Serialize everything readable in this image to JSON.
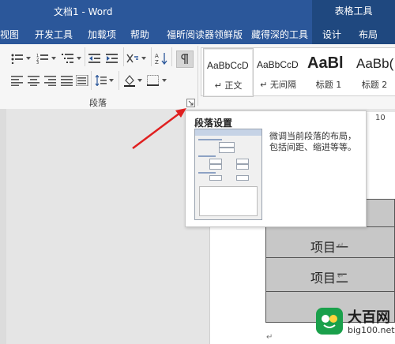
{
  "titlebar": {
    "title": "文档1 - Word",
    "context_tab_title": "表格工具"
  },
  "menu": {
    "items": [
      {
        "label": "视图"
      },
      {
        "label": "开发工具"
      },
      {
        "label": "加载项"
      },
      {
        "label": "帮助"
      },
      {
        "label": "福昕阅读器领鲜版"
      },
      {
        "label": "藏得深的工具"
      },
      {
        "label": "设计"
      },
      {
        "label": "布局"
      }
    ]
  },
  "ribbon": {
    "group_label": "段落",
    "styles": [
      {
        "sample": "AaBbCcD",
        "name": "↵ 正文"
      },
      {
        "sample": "AaBbCcD",
        "name": "↵ 无间隔"
      },
      {
        "sample": "AaBl",
        "name": "标题 1"
      },
      {
        "sample": "AaBb(",
        "name": "标题 2"
      }
    ]
  },
  "tooltip": {
    "title": "段落设置",
    "description": "微调当前段落的布局，包括间距、缩进等等。"
  },
  "ruler": {
    "number": "10"
  },
  "document": {
    "table_rows": [
      {
        "text": ""
      },
      {
        "text": "项目一"
      },
      {
        "text": "项目二"
      },
      {
        "text": ""
      }
    ],
    "return_mark": "↵"
  },
  "watermark": {
    "name": "大百网",
    "url": "big100.net"
  },
  "icons": {
    "bullets": "bullets-icon",
    "numbering": "numbering-icon",
    "multilevel": "multilevel-list-icon",
    "decrease_indent": "decrease-indent-icon",
    "increase_indent": "increase-indent-icon",
    "chinese_layout": "chinese-layout-icon",
    "sort": "sort-icon",
    "show_marks": "show-marks-icon",
    "align_left": "align-left-icon",
    "center": "center-icon",
    "align_right": "align-right-icon",
    "justify": "justify-icon",
    "distributed": "distributed-icon",
    "line_spacing": "line-spacing-icon",
    "shading": "shading-icon",
    "borders": "borders-icon",
    "dialog_launcher": "dialog-launcher-icon"
  },
  "colors": {
    "ribbon_blue": "#2b579a",
    "context_tab": "#1f487f",
    "arrow": "#e02020",
    "table_fill": "#c7c7c7"
  }
}
